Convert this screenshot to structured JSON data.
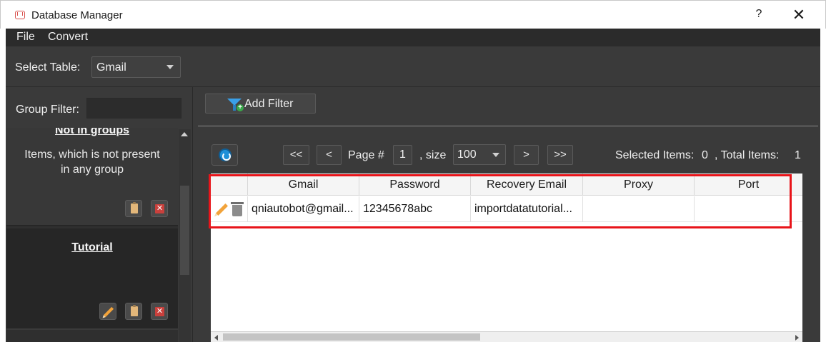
{
  "window": {
    "title": "Database Manager",
    "help_label": "?",
    "close_label": "✕",
    "app_icon": "gmail-logo-icon"
  },
  "menu": {
    "items": [
      "File",
      "Convert"
    ]
  },
  "select_table": {
    "label": "Select Table:",
    "value": "Gmail"
  },
  "group_filter": {
    "label": "Group Filter:",
    "value": ""
  },
  "groups": [
    {
      "title": "Not in groups",
      "description": "Items, which is not present in any group",
      "actions": [
        "clipboard-icon",
        "delete-icon"
      ]
    },
    {
      "title": "Tutorial",
      "description": "",
      "actions": [
        "edit-icon",
        "clipboard-icon",
        "delete-icon"
      ]
    }
  ],
  "filter": {
    "add_label": "Add Filter"
  },
  "pager": {
    "first": "<<",
    "prev": "<",
    "page_label": "Page #",
    "page": "1",
    "size_label": ", size",
    "size": "100",
    "next": ">",
    "last": ">>",
    "selected_label": "Selected Items:",
    "selected_count": "0",
    "total_label": ", Total Items:",
    "total_count": "1"
  },
  "table": {
    "columns": [
      "",
      "Gmail",
      "Password",
      "Recovery Email",
      "Proxy",
      "Port"
    ],
    "rows": [
      {
        "gmail": "qniautobot@gmail...",
        "password": "12345678abc",
        "recovery_email": "importdatatutorial...",
        "proxy": "",
        "port": ""
      }
    ]
  },
  "colors": {
    "highlight": "#e8141a",
    "accent_blue": "#1e90d8",
    "background": "#3a3a3a"
  }
}
